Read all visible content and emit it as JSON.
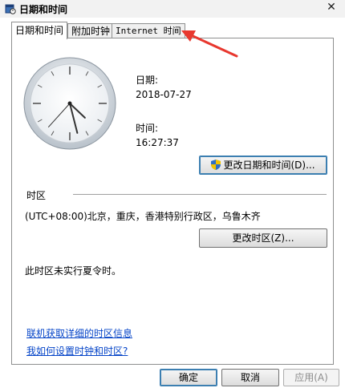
{
  "window": {
    "title": "日期和时间"
  },
  "tabs": [
    {
      "label": "日期和时间"
    },
    {
      "label": "附加时钟"
    },
    {
      "label": "Internet 时间"
    }
  ],
  "date": {
    "label": "日期:",
    "value": "2018-07-27"
  },
  "time": {
    "label": "时间:",
    "value": "16:27:37"
  },
  "buttons": {
    "change_datetime": "更改日期和时间(D)...",
    "change_timezone": "更改时区(Z)...",
    "ok": "确定",
    "cancel": "取消",
    "apply": "应用(A)"
  },
  "timezone": {
    "section_label": "时区",
    "value": "(UTC+08:00)北京，重庆，香港特别行政区，乌鲁木齐",
    "dst_note": "此时区未实行夏令时。"
  },
  "links": {
    "online_tz": "联机获取详细的时区信息",
    "how_to": "我如何设置时钟和时区?"
  },
  "clock": {
    "hours": 16,
    "minutes": 27,
    "seconds": 37
  },
  "colors": {
    "annotation_arrow": "#e8382f",
    "link": "#0645c8"
  }
}
